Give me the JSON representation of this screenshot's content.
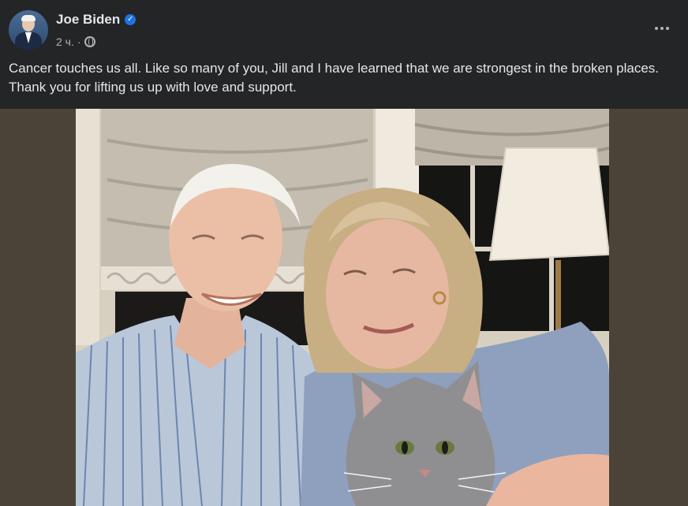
{
  "post": {
    "author": "Joe Biden",
    "verified_icon": "verified-badge-icon",
    "time": "2 ч.",
    "separator": "·",
    "audience_icon": "globe-icon",
    "text": "Cancer touches us all. Like so many of you, Jill and I have learned that we are strongest in the broken places. Thank you for lifting us up with love and support.",
    "more_icon": "more-options-icon",
    "photo_icon": "photo"
  },
  "colors": {
    "background": "#242526",
    "text": "#e4e6eb",
    "secondary_text": "#b0b3b8",
    "verified": "#1b74e4",
    "media_backdrop": "#4c4338"
  }
}
